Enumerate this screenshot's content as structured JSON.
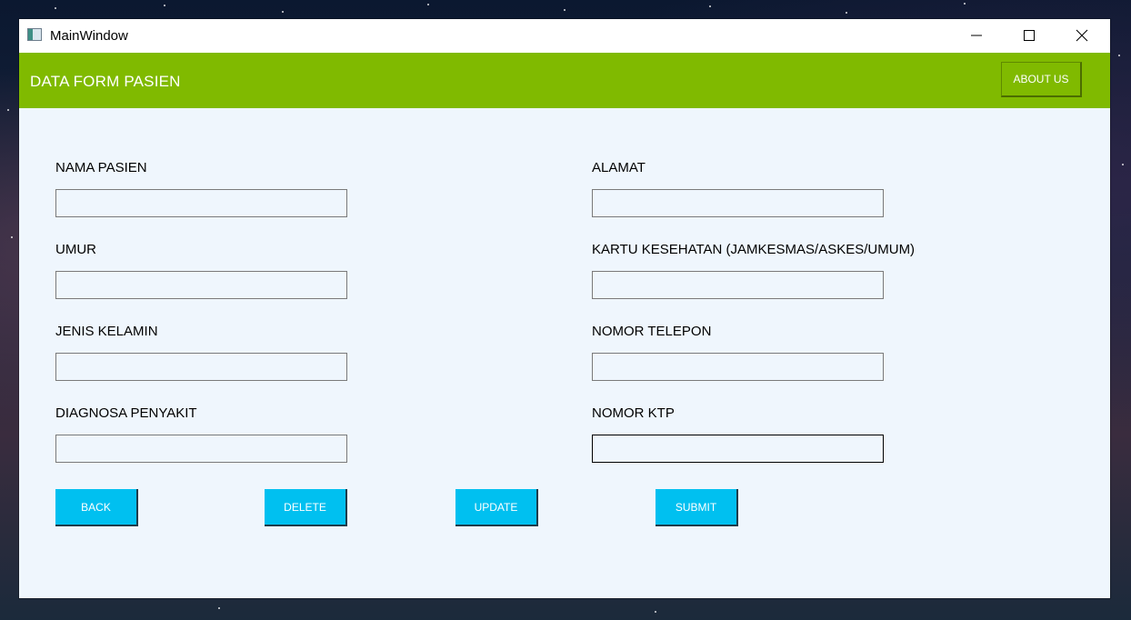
{
  "window": {
    "title": "MainWindow"
  },
  "header": {
    "title": "DATA FORM PASIEN",
    "about_label": "ABOUT US",
    "background": "#80ba00"
  },
  "form": {
    "left_fields": [
      {
        "label": "NAMA PASIEN",
        "value": "",
        "placeholder": ""
      },
      {
        "label": "UMUR",
        "value": "",
        "placeholder": ""
      },
      {
        "label": "JENIS KELAMIN",
        "value": "",
        "placeholder": ""
      },
      {
        "label": "DIAGNOSA PENYAKIT",
        "value": "",
        "placeholder": ""
      }
    ],
    "right_fields": [
      {
        "label": "ALAMAT",
        "value": "",
        "placeholder": ""
      },
      {
        "label": "KARTU KESEHATAN (JAMKESMAS/ASKES/UMUM)",
        "value": "",
        "placeholder": ""
      },
      {
        "label": "NOMOR TELEPON",
        "value": "",
        "placeholder": ""
      },
      {
        "label": "NOMOR KTP",
        "value": "",
        "placeholder": ""
      }
    ]
  },
  "actions": {
    "back_label": "BACK",
    "delete_label": "DELETE",
    "update_label": "UPDATE",
    "submit_label": "SUBMIT",
    "button_color": "#00c0f0"
  },
  "icons": {
    "app": "app-window-icon",
    "minimize": "minimize-icon",
    "maximize": "maximize-icon",
    "close": "close-icon"
  }
}
